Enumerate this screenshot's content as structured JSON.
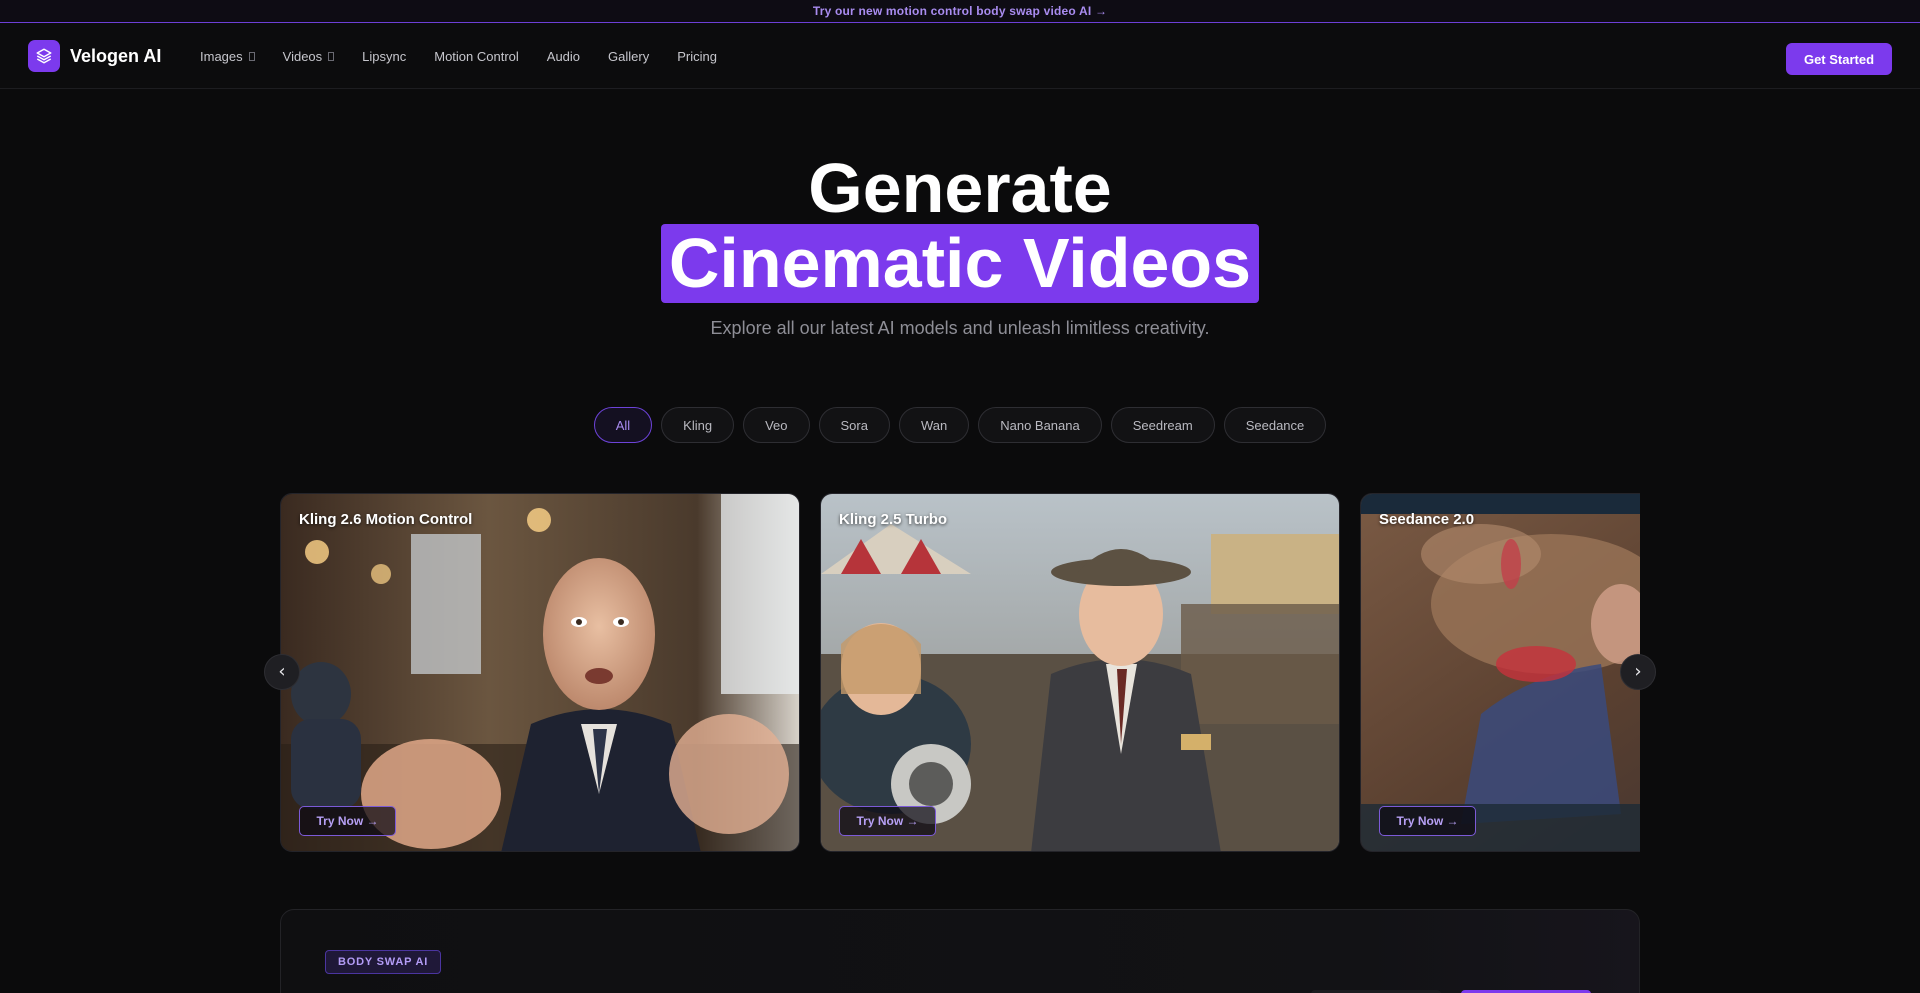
{
  "announcement": {
    "text": "Try our new motion control body swap video AI →"
  },
  "brand": {
    "name": "Velogen AI",
    "logo_icon": "layers-icon",
    "accent": "#7c3aed"
  },
  "nav": {
    "items": [
      {
        "label": "Images",
        "dropdown": true
      },
      {
        "label": "Videos",
        "dropdown": true
      },
      {
        "label": "Lipsync"
      },
      {
        "label": "Motion Control"
      },
      {
        "label": "Audio"
      },
      {
        "label": "Gallery"
      },
      {
        "label": "Pricing"
      }
    ],
    "cta": "Get Started"
  },
  "hero": {
    "title_line1": "Generate",
    "title_line2": "Cinematic Videos",
    "subtitle": "Explore all our latest AI models and unleash limitless creativity."
  },
  "filters": {
    "selected": "All",
    "items": [
      "All",
      "Kling",
      "Veo",
      "Sora",
      "Wan",
      "Nano Banana",
      "Seedream",
      "Seedance"
    ]
  },
  "carousel": {
    "prev_icon": "‹",
    "next_icon": "›",
    "cards": [
      {
        "title": "Kling 2.6 Motion Control",
        "cta": "Try Now →"
      },
      {
        "title": "Kling 2.5 Turbo",
        "cta": "Try Now →"
      },
      {
        "title": "Seedance 2.0",
        "cta": "Try Now →"
      }
    ]
  },
  "next_section": {
    "badge": "BODY SWAP AI"
  }
}
